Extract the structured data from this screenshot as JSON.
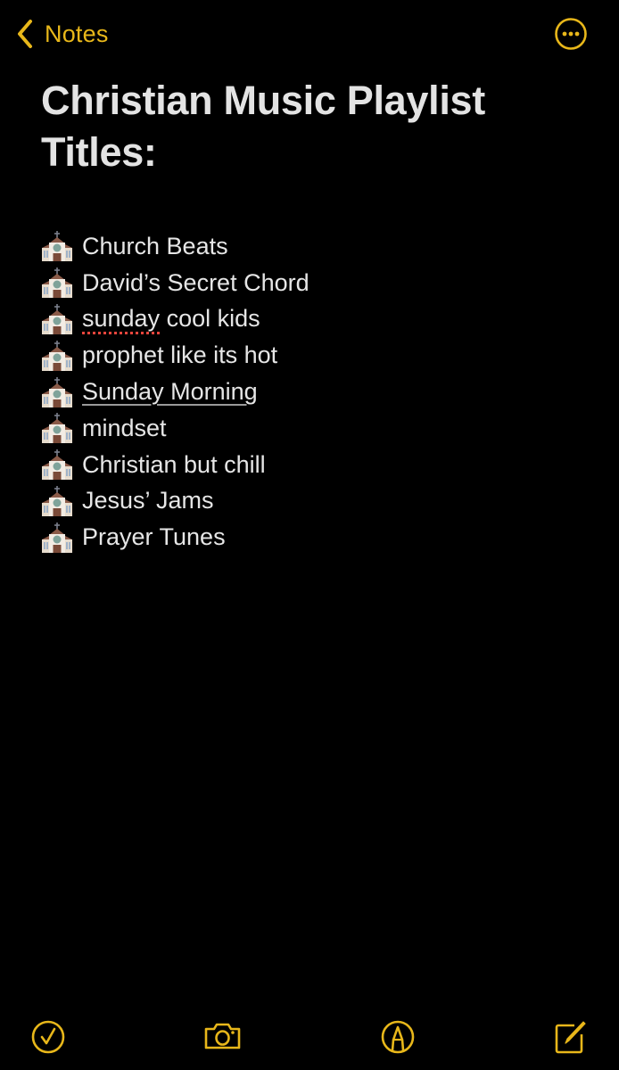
{
  "colors": {
    "accent": "#e8b71a",
    "background": "#000000",
    "text": "#e6e6e6",
    "spellcheck": "#e8453c"
  },
  "navbar": {
    "back_label": "Notes",
    "back_icon": "chevron-left-icon",
    "more_icon": "ellipsis-circle-icon"
  },
  "note": {
    "title": "Christian Music Playlist Titles:",
    "bullet_emoji": "church-emoji",
    "items": [
      {
        "text": "Church Beats"
      },
      {
        "text": "David’s Secret Chord"
      },
      {
        "text": "sunday",
        "suffix": " cool kids",
        "misspelled": "sunday"
      },
      {
        "text": "prophet like its hot"
      },
      {
        "text": "Sunday Morning",
        "linked": true
      },
      {
        "text": "mindset"
      },
      {
        "text": "Christian but chill"
      },
      {
        "text": "Jesus’ Jams"
      },
      {
        "text": "Prayer Tunes"
      }
    ]
  },
  "toolbar": {
    "items": [
      {
        "name": "checklist",
        "icon": "checkmark-circle-icon"
      },
      {
        "name": "camera",
        "icon": "camera-icon"
      },
      {
        "name": "markup",
        "icon": "pen-tip-circle-icon"
      },
      {
        "name": "compose",
        "icon": "square-pencil-icon"
      }
    ]
  }
}
